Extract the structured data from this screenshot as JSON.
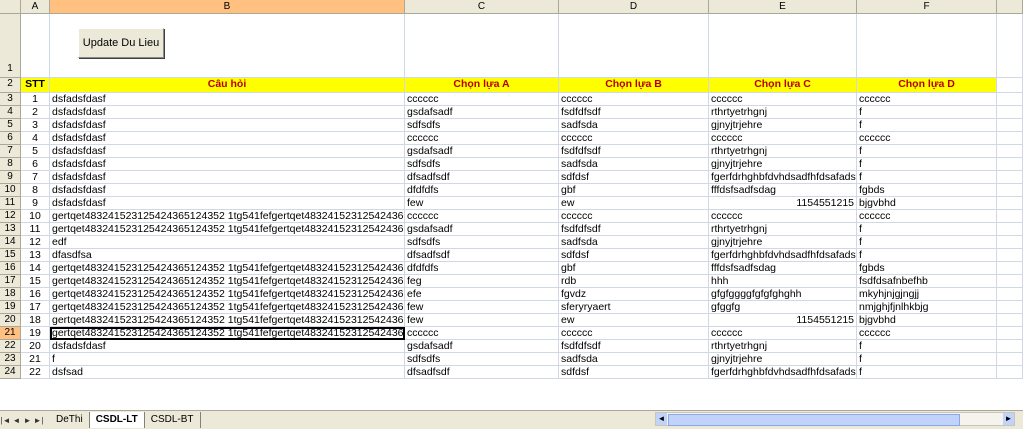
{
  "columns": [
    "A",
    "B",
    "C",
    "D",
    "E",
    "F"
  ],
  "button_label": "Update Du Lieu",
  "row1_number": "1",
  "header_row": {
    "number": "2",
    "cells": [
      "STT",
      "Câu hỏi",
      "Chọn lựa A",
      "Chọn lựa B",
      "Chọn lựa C",
      "Chọn lựa D"
    ]
  },
  "rows": [
    {
      "rn": "3",
      "stt": "1",
      "q": "dsfadsfdasf",
      "a": "cccccc",
      "b": "cccccc",
      "c": "cccccc",
      "d": "cccccc"
    },
    {
      "rn": "4",
      "stt": "2",
      "q": "dsfadsfdasf",
      "a": "gsdafsadf",
      "b": "fsdfdfsdf",
      "c": "rthrtyetrhgnj",
      "d": "f"
    },
    {
      "rn": "5",
      "stt": "3",
      "q": "dsfadsfdasf",
      "a": "sdfsdfs",
      "b": "sadfsda",
      "c": "gjnyjtrjehre",
      "d": "f"
    },
    {
      "rn": "6",
      "stt": "4",
      "q": "dsfadsfdasf",
      "a": "cccccc",
      "b": "cccccc",
      "c": "cccccc",
      "d": "cccccc"
    },
    {
      "rn": "7",
      "stt": "5",
      "q": "dsfadsfdasf",
      "a": "gsdafsadf",
      "b": "fsdfdfsdf",
      "c": "rthrtyetrhgnj",
      "d": "f"
    },
    {
      "rn": "8",
      "stt": "6",
      "q": "dsfadsfdasf",
      "a": "sdfsdfs",
      "b": "sadfsda",
      "c": "gjnyjtrjehre",
      "d": "f"
    },
    {
      "rn": "9",
      "stt": "7",
      "q": "dsfadsfdasf",
      "a": "dfsadfsdf",
      "b": "sdfdsf",
      "c": "fgerfdrhghbfdvhdsadfhfdsafadsf",
      "d": "f"
    },
    {
      "rn": "10",
      "stt": "8",
      "q": "dsfadsfdasf",
      "a": "dfdfdfs",
      "b": "gbf",
      "c": "fffdsfsadfsdag",
      "d": "fgbds"
    },
    {
      "rn": "11",
      "stt": "9",
      "q": "dsfadsfdasf",
      "a": "few",
      "b": "ew",
      "c": "1154551215",
      "d": "bjgvbhd",
      "cr": true
    },
    {
      "rn": "12",
      "stt": "10",
      "q": "gertqet483241523125424365124352 1tg541fefgertqet483241523125424365",
      "a": "cccccc",
      "b": "cccccc",
      "c": "cccccc",
      "d": "cccccc"
    },
    {
      "rn": "13",
      "stt": "11",
      "q": "gertqet483241523125424365124352 1tg541fefgertqet483241523125424365",
      "a": "gsdafsadf",
      "b": "fsdfdfsdf",
      "c": "rthrtyetrhgnj",
      "d": "f"
    },
    {
      "rn": "14",
      "stt": "12",
      "q": "edf",
      "a": "sdfsdfs",
      "b": "sadfsda",
      "c": "gjnyjtrjehre",
      "d": "f"
    },
    {
      "rn": "15",
      "stt": "13",
      "q": "dfasdfsa",
      "a": "dfsadfsdf",
      "b": "sdfdsf",
      "c": "fgerfdrhghbfdvhdsadfhfdsafadsf",
      "d": "f"
    },
    {
      "rn": "16",
      "stt": "14",
      "q": "gertqet483241523125424365124352 1tg541fefgertqet483241523125424365",
      "a": "dfdfdfs",
      "b": "gbf",
      "c": "fffdsfsadfsdag",
      "d": "fgbds"
    },
    {
      "rn": "17",
      "stt": "15",
      "q": "gertqet483241523125424365124352 1tg541fefgertqet483241523125424365",
      "a": "feg",
      "b": "rdb",
      "c": "hhh",
      "d": "fsdfdsafnbefhb"
    },
    {
      "rn": "18",
      "stt": "16",
      "q": "gertqet483241523125424365124352 1tg541fefgertqet483241523125424365",
      "a": "efe",
      "b": "fgvdz",
      "c": "gfgfggggfgfgfghghh",
      "d": "mkyhjnjgjngjj"
    },
    {
      "rn": "19",
      "stt": "17",
      "q": "gertqet483241523125424365124352 1tg541fefgertqet483241523125424365",
      "a": "few",
      "b": "sferyryaert",
      "c": "gfggfg",
      "d": "nmjghjfjnlhkbjg"
    },
    {
      "rn": "20",
      "stt": "18",
      "q": "gertqet483241523125424365124352 1tg541fefgertqet483241523125424365",
      "a": "few",
      "b": "ew",
      "c": "1154551215",
      "d": "bjgvbhd",
      "cr": true
    },
    {
      "rn": "21",
      "stt": "19",
      "q": "gertqet483241523125424365124352 1tg541fefgertqet483241523125424365",
      "a": "cccccc",
      "b": "cccccc",
      "c": "cccccc",
      "d": "cccccc",
      "active": true
    },
    {
      "rn": "22",
      "stt": "20",
      "q": "dsfadsfdasf",
      "a": "gsdafsadf",
      "b": "fsdfdfsdf",
      "c": "rthrtyetrhgnj",
      "d": "f"
    },
    {
      "rn": "23",
      "stt": "21",
      "q": "f",
      "a": "sdfsdfs",
      "b": "sadfsda",
      "c": "gjnyjtrjehre",
      "d": "f"
    },
    {
      "rn": "24",
      "stt": "22",
      "q": "dsfsad",
      "a": "dfsadfsdf",
      "b": "sdfdsf",
      "c": "fgerfdrhghbfdvhdsadfhfdsafadsf",
      "d": "f"
    }
  ],
  "sheet_tabs": [
    "DeThi",
    "CSDL-LT",
    "CSDL-BT"
  ],
  "active_tab": "CSDL-LT",
  "nav_arrows": [
    "|◄",
    "◄",
    "►",
    "►|"
  ]
}
